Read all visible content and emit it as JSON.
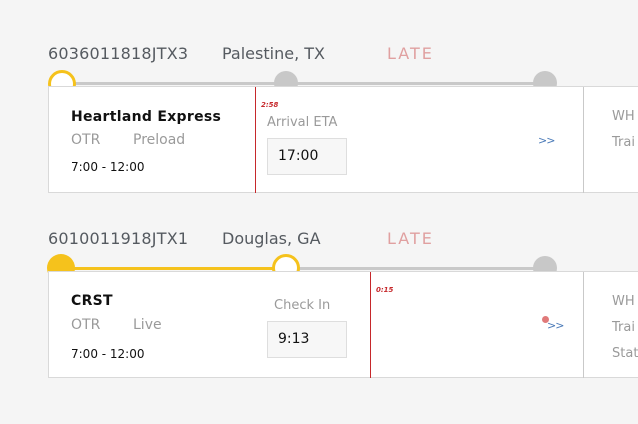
{
  "loads": [
    {
      "id": "6036011818JTX3",
      "city": "Palestine, TX",
      "status": "LATE",
      "carrier": "Heartland Express",
      "tags": [
        "OTR",
        "Preload"
      ],
      "window": "7:00 - 12:00",
      "late_by": "2:58",
      "field_label": "Arrival ETA",
      "field_value": "17:00",
      "chevron": ">>",
      "side": [
        "WH",
        "Trai"
      ]
    },
    {
      "id": "6010011918JTX1",
      "city": "Douglas, GA",
      "status": "LATE",
      "carrier": "CRST",
      "tags": [
        "OTR",
        "Live"
      ],
      "window": "7:00 - 12:00",
      "late_by": "0:15",
      "field_label": "Check In",
      "field_value": "9:13",
      "chevron": ">>",
      "side": [
        "WH",
        "Trai",
        "Stat"
      ]
    }
  ],
  "colors": {
    "accent": "#f5c21c",
    "late": "#e0a0a0",
    "late_marker": "#c6282b",
    "link": "#4a7ab8"
  }
}
